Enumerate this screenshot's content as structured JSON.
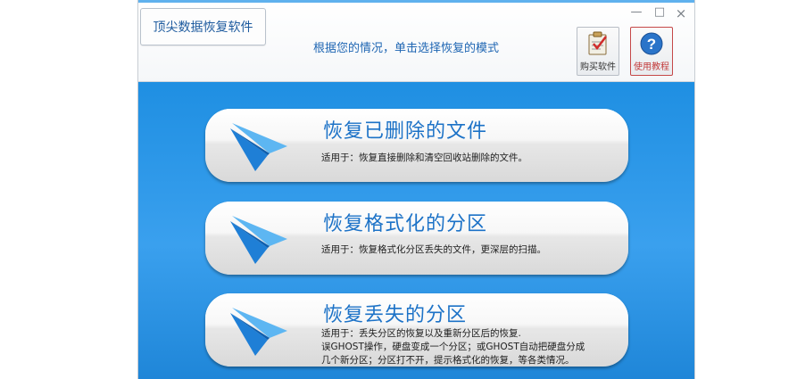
{
  "window": {
    "title": "顶尖数据恢复软件",
    "subtitle": "根据您的情况，单击选择恢复的模式",
    "controls": {
      "minimize": "—",
      "maximize": "□",
      "close": "×"
    }
  },
  "header_buttons": [
    {
      "label": "购买软件",
      "icon": "clipboard-checklist-icon"
    },
    {
      "label": "使用教程",
      "icon": "help-question-icon"
    }
  ],
  "options": [
    {
      "title": "恢复已删除的文件",
      "desc_lines": [
        "适用于：恢复直接删除和清空回收站删除的文件。"
      ]
    },
    {
      "title": "恢复格式化的分区",
      "desc_lines": [
        "适用于：恢复格式化分区丢失的文件，更深层的扫描。"
      ]
    },
    {
      "title": "恢复丢失的分区",
      "desc_lines": [
        "适用于：丢失分区的恢复以及重新分区后的恢复.",
        "误GHOST操作，硬盘变成一个分区；或GHOST自动把硬盘分成",
        "几个新分区；分区打不开，提示格式化的恢复，等各类情况。"
      ]
    }
  ],
  "colors": {
    "accent_blue": "#1f8fe2",
    "title_blue": "#1c72c7",
    "help_red": "#c23a3a"
  }
}
